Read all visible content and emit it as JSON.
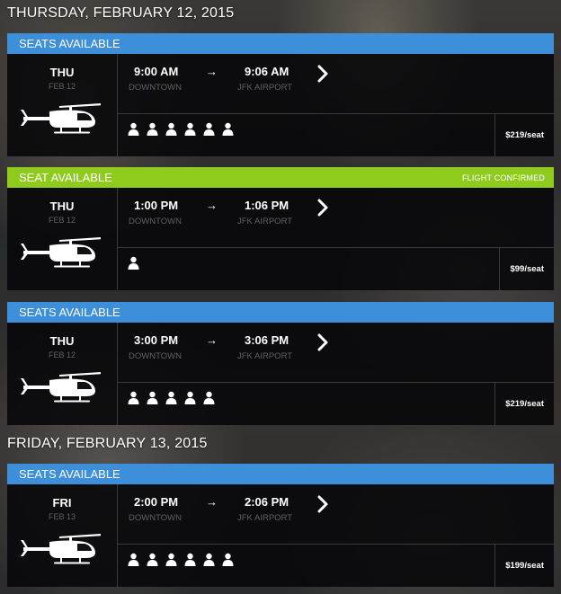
{
  "days": [
    {
      "heading": "THURSDAY, FEBRUARY 12, 2015"
    },
    {
      "heading": "FRIDAY, FEBRUARY 13, 2015"
    }
  ],
  "flights": [
    {
      "status": "SEATS AVAILABLE",
      "status_color": "#3c8fd8",
      "confirmed": "",
      "dow": "THU",
      "date": "FEB 12",
      "depart_time": "9:00 AM",
      "depart_loc": "DOWNTOWN",
      "arrow": "→",
      "arrive_time": "9:06 AM",
      "arrive_loc": "JFK AIRPORT",
      "seats_available": 6,
      "price": "$219/seat"
    },
    {
      "status": "SEAT AVAILABLE",
      "status_color": "#8fcb1d",
      "confirmed": "FLIGHT CONFIRMED",
      "dow": "THU",
      "date": "FEB 12",
      "depart_time": "1:00 PM",
      "depart_loc": "DOWNTOWN",
      "arrow": "→",
      "arrive_time": "1:06 PM",
      "arrive_loc": "JFK AIRPORT",
      "seats_available": 1,
      "price": "$99/seat"
    },
    {
      "status": "SEATS AVAILABLE",
      "status_color": "#3c8fd8",
      "confirmed": "",
      "dow": "THU",
      "date": "FEB 12",
      "depart_time": "3:00 PM",
      "depart_loc": "DOWNTOWN",
      "arrow": "→",
      "arrive_time": "3:06 PM",
      "arrive_loc": "JFK AIRPORT",
      "seats_available": 5,
      "price": "$219/seat"
    },
    {
      "status": "SEATS AVAILABLE",
      "status_color": "#3c8fd8",
      "confirmed": "",
      "dow": "FRI",
      "date": "FEB 13",
      "depart_time": "2:00 PM",
      "depart_loc": "DOWNTOWN",
      "arrow": "→",
      "arrive_time": "2:06 PM",
      "arrive_loc": "JFK AIRPORT",
      "seats_available": 6,
      "price": "$199/seat"
    }
  ],
  "icons": {
    "aircraft": "helicopter-icon",
    "seat": "person-icon",
    "go": "chevron-right-icon"
  }
}
